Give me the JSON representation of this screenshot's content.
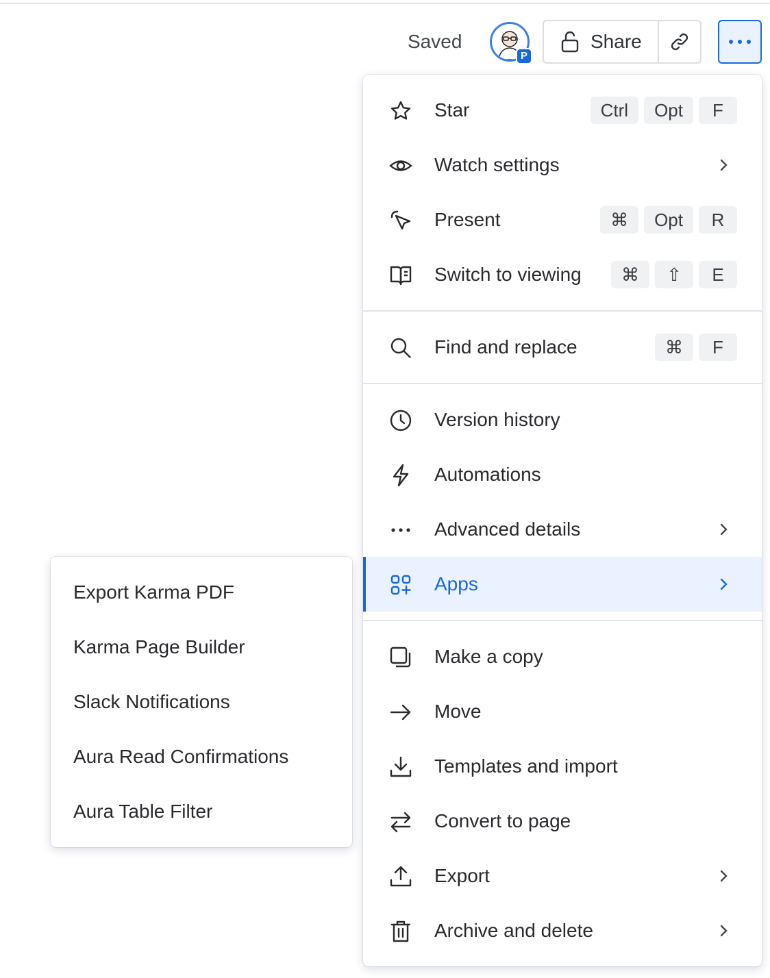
{
  "header": {
    "status": "Saved",
    "avatar_badge": "P",
    "share_label": "Share",
    "icons": [
      "lock-open-icon",
      "link-icon",
      "more-icon"
    ]
  },
  "menu": {
    "items": [
      {
        "label": "Star",
        "icon": "star-icon",
        "shortcut": [
          "Ctrl",
          "Opt",
          "F"
        ]
      },
      {
        "label": "Watch settings",
        "icon": "eye-icon",
        "submenu": true
      },
      {
        "label": "Present",
        "icon": "present-icon",
        "shortcut": [
          "⌘",
          "Opt",
          "R"
        ]
      },
      {
        "label": "Switch to viewing",
        "icon": "book-icon",
        "shortcut": [
          "⌘",
          "⇧",
          "E"
        ]
      },
      {
        "label": "Find and replace",
        "icon": "search-icon",
        "shortcut": [
          "⌘",
          "F"
        ]
      },
      {
        "label": "Version history",
        "icon": "clock-icon"
      },
      {
        "label": "Automations",
        "icon": "lightning-icon"
      },
      {
        "label": "Advanced details",
        "icon": "ellipsis-icon",
        "submenu": true
      },
      {
        "label": "Apps",
        "icon": "apps-icon",
        "submenu": true,
        "active": true
      },
      {
        "label": "Make a copy",
        "icon": "copy-icon"
      },
      {
        "label": "Move",
        "icon": "arrow-right-icon"
      },
      {
        "label": "Templates and import",
        "icon": "download-icon"
      },
      {
        "label": "Convert to page",
        "icon": "swap-icon"
      },
      {
        "label": "Export",
        "icon": "upload-icon",
        "submenu": true
      },
      {
        "label": "Archive and delete",
        "icon": "trash-icon",
        "submenu": true
      }
    ]
  },
  "apps_submenu": {
    "items": [
      {
        "label": "Export Karma PDF"
      },
      {
        "label": "Karma Page Builder"
      },
      {
        "label": "Slack Notifications"
      },
      {
        "label": "Aura Read Confirmations"
      },
      {
        "label": "Aura Table Filter"
      }
    ]
  },
  "colors": {
    "accent": "#1868db",
    "active_bg": "#e9f2fe",
    "key_bg": "#f0f1f2",
    "divider": "#e3e4e8"
  }
}
